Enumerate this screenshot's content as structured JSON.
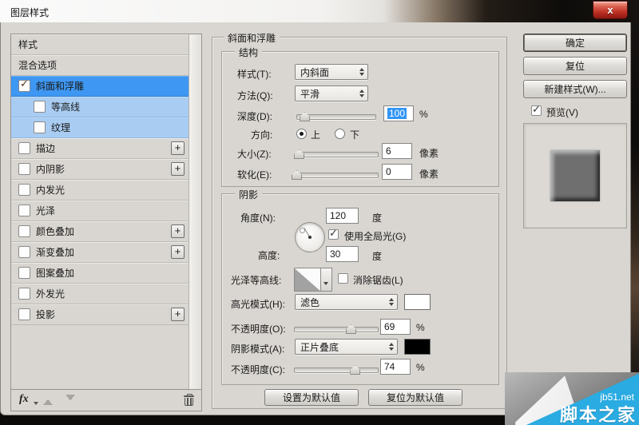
{
  "window": {
    "title": "图层样式"
  },
  "icons": {
    "close": "x",
    "check": "✓",
    "plus": "+",
    "fx": "fx"
  },
  "sidebar": {
    "items": [
      {
        "label": "样式",
        "checkbox": false
      },
      {
        "label": "混合选项",
        "checkbox": false
      },
      {
        "label": "斜面和浮雕",
        "checkbox": true,
        "checked": true,
        "selected": true
      },
      {
        "label": "等高线",
        "checkbox": true,
        "checked": false,
        "sub": true
      },
      {
        "label": "纹理",
        "checkbox": true,
        "checked": false,
        "sub": true
      },
      {
        "label": "描边",
        "checkbox": true,
        "checked": false,
        "plus": true
      },
      {
        "label": "内阴影",
        "checkbox": true,
        "checked": false,
        "plus": true
      },
      {
        "label": "内发光",
        "checkbox": true,
        "checked": false
      },
      {
        "label": "光泽",
        "checkbox": true,
        "checked": false
      },
      {
        "label": "颜色叠加",
        "checkbox": true,
        "checked": false,
        "plus": true
      },
      {
        "label": "渐变叠加",
        "checkbox": true,
        "checked": false,
        "plus": true
      },
      {
        "label": "图案叠加",
        "checkbox": true,
        "checked": false
      },
      {
        "label": "外发光",
        "checkbox": true,
        "checked": false
      },
      {
        "label": "投影",
        "checkbox": true,
        "checked": false,
        "plus": true
      }
    ]
  },
  "panel": {
    "title": "斜面和浮雕",
    "structure": {
      "legend": "结构",
      "style_label": "样式(T):",
      "style_value": "内斜面",
      "technique_label": "方法(Q):",
      "technique_value": "平滑",
      "depth_label": "深度(D):",
      "depth_value": "100",
      "depth_unit": "%",
      "direction_label": "方向:",
      "direction_up": "上",
      "direction_down": "下",
      "size_label": "大小(Z):",
      "size_value": "6",
      "size_unit": "像素",
      "soften_label": "软化(E):",
      "soften_value": "0",
      "soften_unit": "像素"
    },
    "shading": {
      "legend": "阴影",
      "angle_label": "角度(N):",
      "angle_value": "120",
      "angle_unit": "度",
      "global_light_label": "使用全局光(G)",
      "altitude_label": "高度:",
      "altitude_value": "30",
      "altitude_unit": "度",
      "gloss_contour_label": "光泽等高线:",
      "antialias_label": "消除锯齿(L)",
      "highlight_mode_label": "高光模式(H):",
      "highlight_mode_value": "滤色",
      "highlight_opacity_label": "不透明度(O):",
      "highlight_opacity_value": "69",
      "highlight_opacity_unit": "%",
      "shadow_mode_label": "阴影模式(A):",
      "shadow_mode_value": "正片叠底",
      "shadow_opacity_label": "不透明度(C):",
      "shadow_opacity_value": "74",
      "shadow_opacity_unit": "%"
    },
    "footer_buttons": {
      "set_default": "设置为默认值",
      "reset_default": "复位为默认值"
    }
  },
  "actions": {
    "ok": "确定",
    "reset": "复位",
    "new_style": "新建样式(W)...",
    "preview": "预览(V)"
  },
  "watermark": {
    "site": "jb51.net",
    "name": "脚本之家",
    "color": "#2aabe2"
  },
  "colors": {
    "selected_row": "#3e97f2",
    "sub_row": "#a9ccf2",
    "dialog_bg": "#d9d6d1",
    "highlight_swatch": "#ffffff",
    "shadow_swatch": "#000000",
    "selection_text_bg": "#3195f5"
  }
}
